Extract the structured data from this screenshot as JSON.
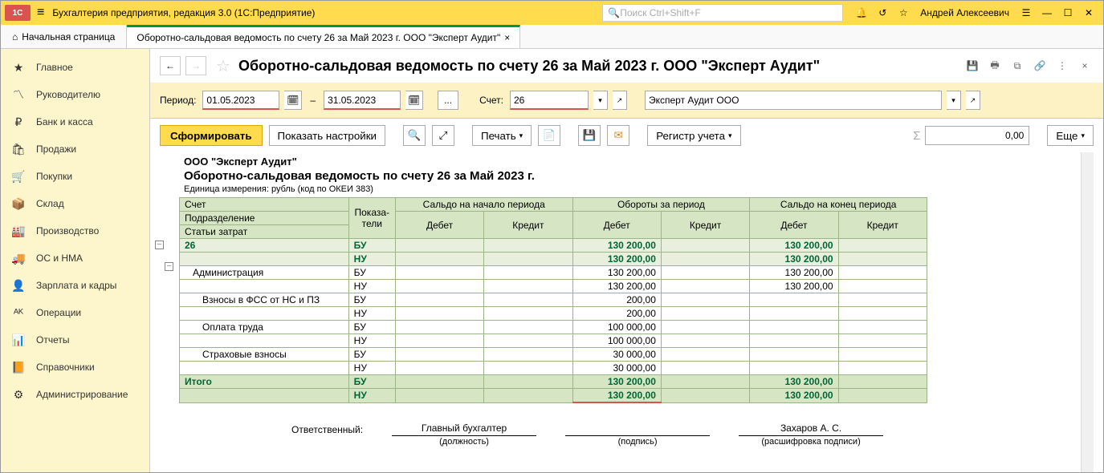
{
  "app": {
    "title": "Бухгалтерия предприятия, редакция 3.0  (1С:Предприятие)",
    "search_placeholder": "Поиск Ctrl+Shift+F",
    "user": "Андрей Алексеевич"
  },
  "tabs": {
    "home": "Начальная страница",
    "active": "Оборотно-сальдовая ведомость по счету 26 за Май 2023 г. ООО \"Эксперт Аудит\""
  },
  "sidebar": [
    {
      "icon": "★",
      "label": "Главное"
    },
    {
      "icon": "〽",
      "label": "Руководителю"
    },
    {
      "icon": "₽",
      "label": "Банк и касса"
    },
    {
      "icon": "🛍",
      "label": "Продажи"
    },
    {
      "icon": "🛒",
      "label": "Покупки"
    },
    {
      "icon": "📦",
      "label": "Склад"
    },
    {
      "icon": "🏭",
      "label": "Производство"
    },
    {
      "icon": "🚚",
      "label": "ОС и НМА"
    },
    {
      "icon": "👤",
      "label": "Зарплата и кадры"
    },
    {
      "icon": "ᴬᴷ",
      "label": "Операции"
    },
    {
      "icon": "📊",
      "label": "Отчеты"
    },
    {
      "icon": "📙",
      "label": "Справочники"
    },
    {
      "icon": "⚙",
      "label": "Администрирование"
    }
  ],
  "page": {
    "title": "Оборотно-сальдовая ведомость по счету 26 за Май 2023 г. ООО \"Эксперт Аудит\""
  },
  "params": {
    "period_label": "Период:",
    "date_from": "01.05.2023",
    "date_to": "31.05.2023",
    "range_sep": "–",
    "ellipsis": "...",
    "account_label": "Счет:",
    "account": "26",
    "org": "Эксперт Аудит ООО"
  },
  "toolbar": {
    "form": "Сформировать",
    "show_settings": "Показать настройки",
    "print": "Печать",
    "register": "Регистр учета",
    "sigma": "Σ",
    "sum": "0,00",
    "more": "Еще"
  },
  "report": {
    "org": "ООО \"Эксперт Аудит\"",
    "title": "Оборотно-сальдовая ведомость по счету 26 за Май 2023 г.",
    "unit": "Единица измерения: рубль (код по ОКЕИ 383)",
    "headers": {
      "account": "Счет",
      "subdiv": "Подразделение",
      "cost_items": "Статьи затрат",
      "pokaz": "Показа-\nтели",
      "saldo_start": "Сальдо на начало периода",
      "turnover": "Обороты за период",
      "saldo_end": "Сальдо на конец периода",
      "debit": "Дебет",
      "credit": "Кредит"
    },
    "rows": [
      {
        "type": "acc",
        "label": "26",
        "ind": "БУ",
        "t_d": "130 200,00",
        "e_d": "130 200,00"
      },
      {
        "type": "acc2",
        "label": "",
        "ind": "НУ",
        "t_d": "130 200,00",
        "e_d": "130 200,00"
      },
      {
        "type": "sub1",
        "label": "Администрация",
        "indent": 1,
        "ind": "БУ",
        "t_d": "130 200,00",
        "e_d": "130 200,00"
      },
      {
        "type": "sub1b",
        "label": "",
        "indent": 1,
        "ind": "НУ",
        "t_d": "130 200,00",
        "e_d": "130 200,00"
      },
      {
        "type": "sub2",
        "label": "Взносы в ФСС от НС и ПЗ",
        "indent": 2,
        "ind": "БУ",
        "t_d": "200,00"
      },
      {
        "type": "sub2b",
        "label": "",
        "indent": 2,
        "ind": "НУ",
        "t_d": "200,00"
      },
      {
        "type": "sub2",
        "label": "Оплата труда",
        "indent": 2,
        "ind": "БУ",
        "t_d": "100 000,00"
      },
      {
        "type": "sub2b",
        "label": "",
        "indent": 2,
        "ind": "НУ",
        "t_d": "100 000,00"
      },
      {
        "type": "sub2",
        "label": "Страховые взносы",
        "indent": 2,
        "ind": "БУ",
        "t_d": "30 000,00"
      },
      {
        "type": "sub2b",
        "label": "",
        "indent": 2,
        "ind": "НУ",
        "t_d": "30 000,00"
      },
      {
        "type": "total",
        "label": "Итого",
        "ind": "БУ",
        "t_d": "130 200,00",
        "e_d": "130 200,00"
      },
      {
        "type": "total2",
        "label": "",
        "ind": "НУ",
        "t_d": "130 200,00",
        "e_d": "130 200,00",
        "underline": true
      }
    ],
    "sign": {
      "resp": "Ответственный:",
      "position": "Главный бухгалтер",
      "position_lbl": "(должность)",
      "sign_lbl": "(подпись)",
      "name": "Захаров А. С.",
      "name_lbl": "(расшифровка подписи)"
    }
  }
}
